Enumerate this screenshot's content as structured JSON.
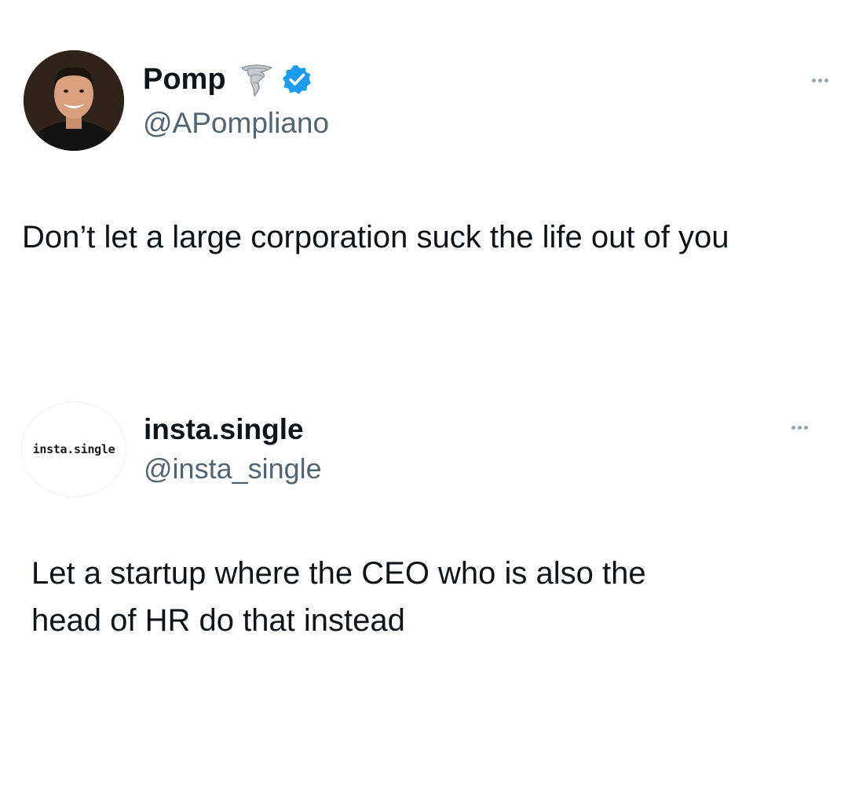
{
  "tweets": [
    {
      "author_name": "Pomp",
      "author_handle": "@APompliano",
      "text": "Don’t let a large corporation suck the life out of you",
      "avatar_icon": "person-photo-avatar",
      "badges": [
        "tornado-icon",
        "verified-icon"
      ],
      "menu_icon": "more-options-icon"
    },
    {
      "author_name": "insta.single",
      "author_handle": "@insta_single",
      "avatar_text": "insta.single",
      "text": "Let a startup where the CEO who is also the head of HR do that instead",
      "menu_icon": "more-options-icon"
    }
  ],
  "colors": {
    "text_primary": "#0f1419",
    "text_secondary": "#536471",
    "verified_blue": "#1d9bf0",
    "background": "#ffffff"
  }
}
